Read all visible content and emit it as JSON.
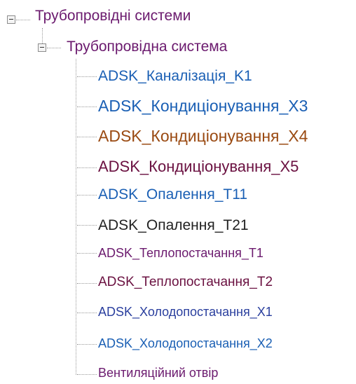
{
  "tree": {
    "root": {
      "label": "Трубопровідні системи",
      "color": "#6b1a6e",
      "expanded": true,
      "toggle_icon": "collapse-minus-icon"
    },
    "system_type": {
      "label": "Трубопровідна система",
      "color": "#6b1a6e",
      "expanded": true,
      "toggle_icon": "collapse-minus-icon"
    },
    "items": [
      {
        "label": "ADSK_Каналізація_K1",
        "color": "#1a5fb4"
      },
      {
        "label": "ADSK_Кондиціонування_X3",
        "color": "#1a5fb4"
      },
      {
        "label": "ADSK_Кондиціонування_X4",
        "color": "#9a4a12"
      },
      {
        "label": "ADSK_Кондиціонування_X5",
        "color": "#6a1040"
      },
      {
        "label": "ADSK_Опалення_T11",
        "color": "#1a5fb4"
      },
      {
        "label": "ADSK_Опалення_T21",
        "color": "#222222"
      },
      {
        "label": "ADSK_Теплопостачання_T1",
        "color": "#6b1a6e"
      },
      {
        "label": "ADSK_Теплопостачання_T2",
        "color": "#6a1040"
      },
      {
        "label": "ADSK_Холодопостачання_X1",
        "color": "#2a3f9e"
      },
      {
        "label": "ADSK_Холодопостачання_X2",
        "color": "#1a5fb4"
      },
      {
        "label": "Вентиляційний отвір",
        "color": "#6b1a6e"
      }
    ]
  }
}
